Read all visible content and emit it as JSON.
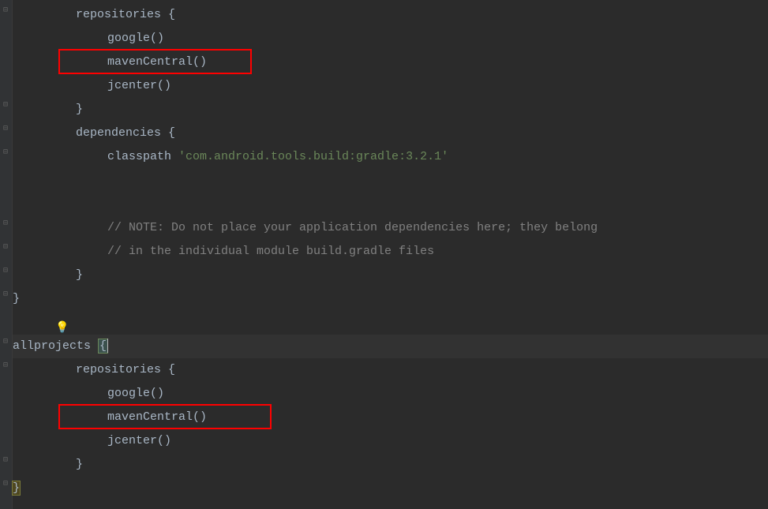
{
  "code": {
    "l1_repositories": "repositories",
    "l1_brace": " {",
    "l2_google": "google()",
    "l3_mavenCentral": "mavenCentral()",
    "l4_jcenter": "jcenter()",
    "l5_close": "}",
    "l6_dependencies": "dependencies",
    "l6_brace": " {",
    "l7_classpath": "classpath",
    "l7_str": " 'com.android.tools.build:gradle:3.2.1'",
    "l8_blank": "",
    "l9_blank": "",
    "l10_comment": "// NOTE: Do not place your application dependencies here; they belong",
    "l11_comment": "// in the individual module build.gradle files",
    "l12_close": "}",
    "l13_close": "}",
    "l14_blank": "",
    "l15_allprojects": "allprojects",
    "l15_brace_open": "{",
    "l16_repositories": "repositories",
    "l16_brace": " {",
    "l17_google": "google()",
    "l18_mavenCentral": "mavenCentral()",
    "l19_jcenter": "jcenter()",
    "l20_close": "}",
    "l21_close": "}"
  },
  "icons": {
    "bulb": "💡"
  }
}
